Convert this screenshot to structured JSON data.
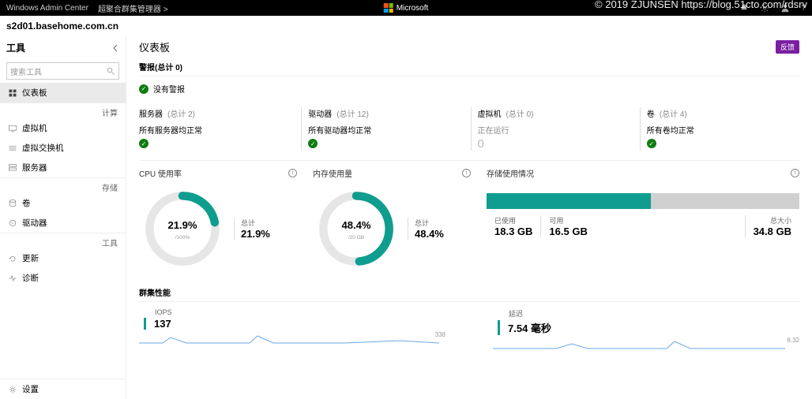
{
  "topbar": {
    "product": "Windows Admin Center",
    "context": "超聚合群集管理器 >",
    "brand": "Microsoft",
    "right_icons": [
      "notifications-icon",
      "settings-icon",
      "user-icon",
      "help-icon"
    ]
  },
  "watermark": "© 2019 ZJUNSEN https://blog.51cto.com/rdsrv",
  "hostname": "s2d01.basehome.com.cn",
  "sidebar": {
    "title": "工具",
    "search_placeholder": "搜索工具",
    "sections": [
      {
        "label": "",
        "items": [
          {
            "name": "仪表板",
            "active": true
          }
        ]
      },
      {
        "label": "计算",
        "items": [
          {
            "name": "虚拟机"
          },
          {
            "name": "虚拟交换机"
          },
          {
            "name": "服务器"
          }
        ]
      },
      {
        "label": "存储",
        "items": [
          {
            "name": "卷"
          },
          {
            "name": "驱动器"
          }
        ]
      },
      {
        "label": "工具",
        "items": [
          {
            "name": "更新"
          },
          {
            "name": "诊断"
          }
        ]
      }
    ],
    "bottom": {
      "name": "设置"
    }
  },
  "content": {
    "title": "仪表板",
    "feedback": "反馈",
    "alerts": {
      "label": "警报(总计 0)",
      "ok_text": "没有警报"
    },
    "cards": [
      {
        "title": "服务器",
        "count": "(总计 2)",
        "status": "所有服务器均正常",
        "type": "ok"
      },
      {
        "title": "驱动器",
        "count": "(总计 12)",
        "status": "所有驱动器均正常",
        "type": "ok"
      },
      {
        "title": "虚拟机",
        "count": "(总计 0)",
        "status": "正在运行",
        "value": "0",
        "type": "zero"
      },
      {
        "title": "卷",
        "count": "(总计 4)",
        "status": "所有卷均正常",
        "type": "ok"
      }
    ],
    "cpu": {
      "label": "CPU 使用率",
      "percent": 21.9,
      "sub": "/100%",
      "total_label": "总计",
      "total_value": "21.9%"
    },
    "mem": {
      "label": "内存使用量",
      "percent": 48.4,
      "sub": "/20 GB",
      "total_label": "总计",
      "total_value": "48.4%"
    },
    "storage": {
      "label": "存储使用情况",
      "used_label": "已使用",
      "used": "18.3 GB",
      "avail_label": "可用",
      "avail": "16.5 GB",
      "total_label": "总大小",
      "total": "34.8 GB",
      "fill_pct": 52.6
    },
    "perf": {
      "section": "群集性能",
      "iops_label": "IOPS",
      "iops": "137",
      "iops_tick": "338",
      "latency_label": "延迟",
      "latency": "7.54 毫秒",
      "latency_tick": "8.32"
    }
  },
  "chart_data": [
    {
      "type": "pie",
      "title": "CPU 使用率",
      "categories": [
        "used",
        "free"
      ],
      "values": [
        21.9,
        78.1
      ],
      "unit": "%",
      "ylim": [
        0,
        100
      ]
    },
    {
      "type": "pie",
      "title": "内存使用量",
      "categories": [
        "used",
        "free"
      ],
      "values": [
        48.4,
        51.6
      ],
      "unit": "%",
      "ylim": [
        0,
        100
      ],
      "total_gb": 20
    },
    {
      "type": "bar",
      "title": "存储使用情况",
      "categories": [
        "已使用",
        "可用"
      ],
      "values": [
        18.3,
        16.5
      ],
      "total": 34.8,
      "unit": "GB"
    }
  ]
}
